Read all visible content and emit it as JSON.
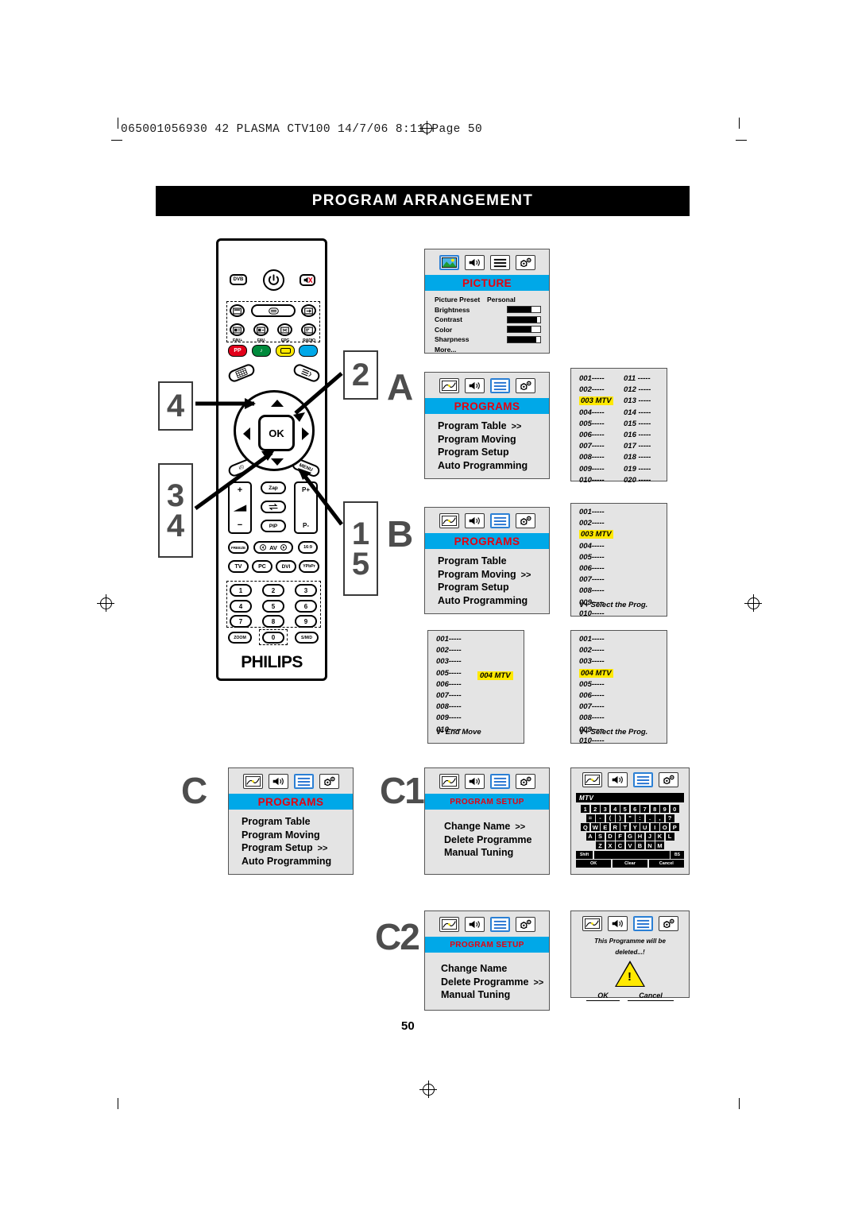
{
  "header": {
    "print_line": "065001056930  42 PLASMA CTV100   14/7/06   8:11   Page 50",
    "title": "PROGRAM ARRANGEMENT",
    "page_number": "50"
  },
  "remote": {
    "brand": "PHILIPS",
    "dvb_label": "DVB",
    "ok_label": "OK",
    "menu_label": "MENU",
    "teletext_label": "TEXT",
    "color_labels": [
      "FAV+",
      "FAV-",
      "EPG",
      "RADIO"
    ],
    "color_values": [
      "#e2001a",
      "#008a3c",
      "#ffe900",
      "#00a8e8"
    ],
    "pp_label": "PP",
    "zap_label": "Zap",
    "pip_label": "PIP",
    "p_up_label": "P+",
    "p_down_label": "P-",
    "vol_up_label": "+",
    "vol_down_label": "−",
    "freeze_label": "FREEZE",
    "av_label": "AV",
    "aspect_label": "16:9",
    "source_labels": [
      "TV",
      "PC",
      "DVI",
      "YPbPr"
    ],
    "keypad": [
      "1",
      "2",
      "3",
      "4",
      "5",
      "6",
      "7",
      "8",
      "9"
    ],
    "zoom_label": "ZOOM",
    "zero_label": "0",
    "smd_label": "S/M/D"
  },
  "steps": {
    "box_top_left": [
      "4"
    ],
    "box_bottom_left": [
      "3",
      "4"
    ],
    "box_top_right": [
      "2"
    ],
    "box_bottom_right": [
      "1",
      "5"
    ],
    "letter_a": "A",
    "letter_b": "B",
    "letter_c": "C",
    "letter_c1": "C1",
    "letter_c2": "C2"
  },
  "icons": {
    "picture": "picture-icon",
    "sound": "speaker-icon",
    "programs": "list-icon",
    "features": "gear-icon"
  },
  "picture_menu": {
    "title": "PICTURE",
    "preset_label": "Picture Preset",
    "preset_value": "Personal",
    "rows": [
      {
        "label": "Brightness",
        "value": 72
      },
      {
        "label": "Contrast",
        "value": 90
      },
      {
        "label": "Color",
        "value": 72
      },
      {
        "label": "Sharpness",
        "value": 88
      }
    ],
    "more_label": "More..."
  },
  "programs_menu_a": {
    "title": "PROGRAMS",
    "items": [
      {
        "label": "Program Table",
        "chevron": ">>"
      },
      {
        "label": "Program Moving",
        "chevron": ""
      },
      {
        "label": "Program Setup",
        "chevron": ""
      },
      {
        "label": "Auto Programming",
        "chevron": ""
      }
    ]
  },
  "programs_menu_b": {
    "title": "PROGRAMS",
    "items": [
      {
        "label": "Program Table",
        "chevron": ""
      },
      {
        "label": "Program Moving",
        "chevron": ">>"
      },
      {
        "label": "Program Setup",
        "chevron": ""
      },
      {
        "label": "Auto Programming",
        "chevron": ""
      }
    ]
  },
  "programs_menu_c": {
    "title": "PROGRAMS",
    "items": [
      {
        "label": "Program Table",
        "chevron": ""
      },
      {
        "label": "Program Moving",
        "chevron": ""
      },
      {
        "label": "Program Setup",
        "chevron": ">>"
      },
      {
        "label": "Auto Programming",
        "chevron": ""
      }
    ]
  },
  "program_setup_c1": {
    "title": "PROGRAM SETUP",
    "items": [
      {
        "label": "Change Name",
        "chevron": ">>"
      },
      {
        "label": "Delete Programme",
        "chevron": ""
      },
      {
        "label": "Manual Tuning",
        "chevron": ""
      }
    ]
  },
  "program_setup_c2": {
    "title": "PROGRAM SETUP",
    "items": [
      {
        "label": "Change Name",
        "chevron": ""
      },
      {
        "label": "Delete Programme",
        "chevron": ">>"
      },
      {
        "label": "Manual Tuning",
        "chevron": ""
      }
    ]
  },
  "table_two_col": {
    "left": [
      "001-----",
      "002-----",
      "003 MTV",
      "004-----",
      "005-----",
      "006-----",
      "007-----",
      "008-----",
      "009-----",
      "010-----"
    ],
    "right": [
      "011 -----",
      "012 -----",
      "013 -----",
      "014 -----",
      "015 -----",
      "016 -----",
      "017 -----",
      "018 -----",
      "019 -----",
      "020 -----"
    ],
    "highlight_index": 2
  },
  "list_select_003": {
    "items": [
      "001-----",
      "002-----",
      "003 MTV",
      "004-----",
      "005-----",
      "006-----",
      "007-----",
      "008-----",
      "009-----",
      "010-----"
    ],
    "highlight_index": 2,
    "footer": "V+ Select the Prog."
  },
  "list_moving": {
    "items": [
      "001-----",
      "002-----",
      "003-----",
      "",
      "005-----",
      "006-----",
      "007-----",
      "008-----",
      "009-----",
      "010-----"
    ],
    "floating_label": "004 MTV",
    "footer": "V- End Move"
  },
  "list_placed_004": {
    "items": [
      "001-----",
      "002-----",
      "003-----",
      "004 MTV",
      "005-----",
      "006-----",
      "007-----",
      "008-----",
      "009-----",
      "010-----"
    ],
    "highlight_index": 3,
    "footer": "V+ Select the Prog."
  },
  "keyboard": {
    "field_value": "MTV",
    "rows": [
      [
        "1",
        "2",
        "3",
        "4",
        "5",
        "6",
        "7",
        "8",
        "9",
        "0"
      ],
      [
        "=",
        "-",
        "(",
        ")",
        "\"",
        ":",
        ".",
        ",",
        "?"
      ],
      [
        "Q",
        "W",
        "E",
        "R",
        "T",
        "Y",
        "U",
        "I",
        "O",
        "P"
      ],
      [
        "A",
        "S",
        "D",
        "F",
        "G",
        "H",
        "J",
        "K",
        "L"
      ],
      [
        "Z",
        "X",
        "C",
        "V",
        "B",
        "N",
        "M"
      ]
    ],
    "shift_label": "Shift",
    "bs_label": "BS",
    "ok_label": "OK",
    "clear_label": "Clear",
    "cancel_label": "Cancel"
  },
  "delete_dialog": {
    "message_line1": "This Programme will be",
    "message_line2": "deleted...!",
    "ok_label": "OK",
    "cancel_label": "Cancel"
  },
  "colors": {
    "osd_title_bg": "#00a8e8",
    "osd_title_text": "#e8000d",
    "osd_bg": "#e4e4e4",
    "highlight": "#ffe900",
    "step_gray": "#4d4d4d"
  }
}
